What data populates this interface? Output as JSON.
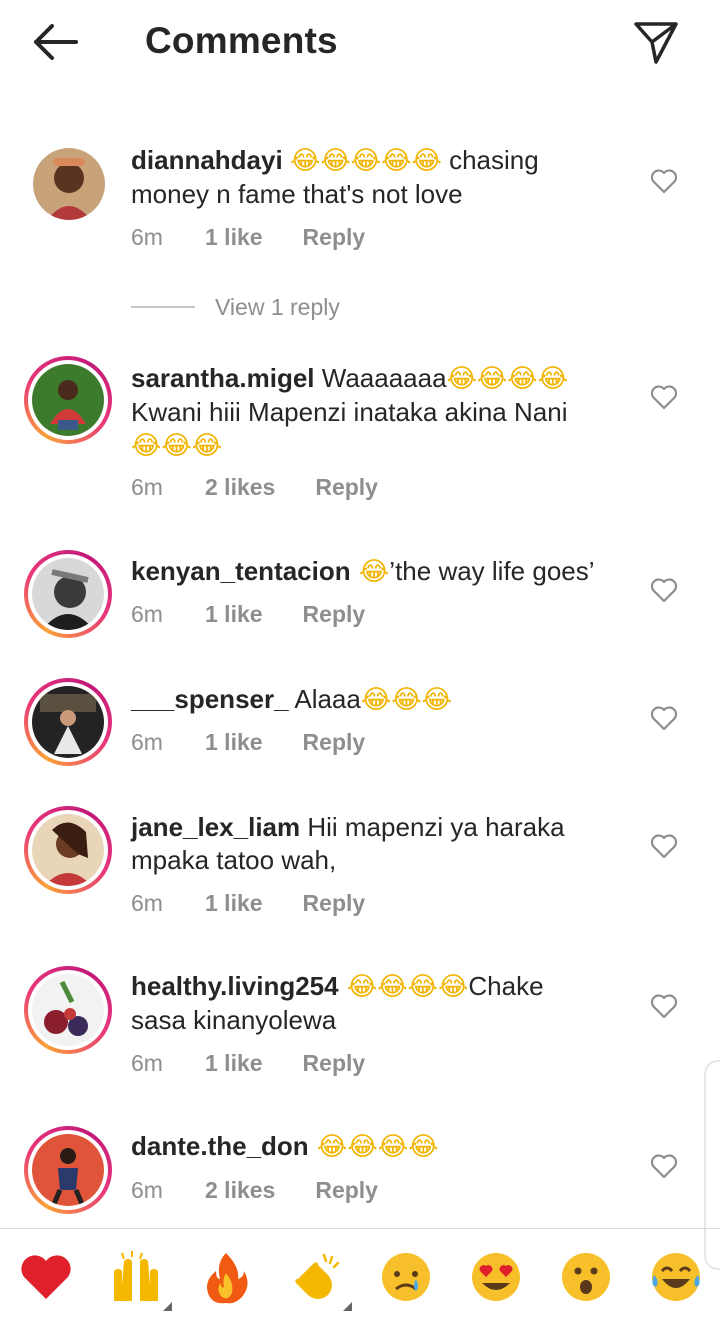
{
  "header": {
    "title": "Comments"
  },
  "comments": [
    {
      "username": "diannahdayi",
      "line1_emojis": "😂😂😂😂😂",
      "text_line1": " chasing",
      "text_line2": "money n fame that's not love",
      "time": "6m",
      "likes": "1 like",
      "reply": "Reply"
    },
    {
      "username": "sarantha.migel",
      "text_line1": " Waaaaaaa",
      "line1_emojis": "😂😂😂😂",
      "text_line2": "Kwani hiii Mapenzi inataka akina Nani",
      "line3_emojis": "😂😂😂",
      "time": "6m",
      "likes": "2 likes",
      "reply": "Reply"
    },
    {
      "username": "kenyan_tentacion",
      "line1_emojis": " 😂",
      "text_line1": "’the way life goes’",
      "time": "6m",
      "likes": "1 like",
      "reply": "Reply"
    },
    {
      "username": "___spenser_",
      "text_line1": " Alaaa",
      "line1_emojis": "😂😂😂",
      "time": "6m",
      "likes": "1 like",
      "reply": "Reply"
    },
    {
      "username": "jane_lex_liam",
      "text_line1": " Hii mapenzi ya haraka",
      "text_line2": "mpaka tatoo wah,",
      "time": "6m",
      "likes": "1 like",
      "reply": "Reply"
    },
    {
      "username": "healthy.living254",
      "line1_emojis": " 😂😂😂😂",
      "text_line1": "Chake",
      "text_line2": "sasa kinanyolewa",
      "time": "6m",
      "likes": "1 like",
      "reply": "Reply"
    },
    {
      "username": "dante.the_don",
      "line1_emojis": " 😂😂😂😂",
      "time": "6m",
      "likes": "2 likes",
      "reply": "Reply"
    }
  ],
  "view_replies": {
    "label": "View 1 reply"
  },
  "icons": {
    "back": "arrow-left-icon",
    "send": "paper-plane-icon",
    "like": "heart-outline-icon"
  },
  "quick_reactions": [
    {
      "name": "red-heart",
      "glyph": "❤️"
    },
    {
      "name": "raising-hands",
      "glyph": "🙌"
    },
    {
      "name": "fire",
      "glyph": "🔥"
    },
    {
      "name": "clapping-hands",
      "glyph": "👏"
    },
    {
      "name": "crying-face",
      "glyph": "😢"
    },
    {
      "name": "heart-eyes",
      "glyph": "😍"
    },
    {
      "name": "surprised-face",
      "glyph": "😮"
    },
    {
      "name": "tears-of-joy",
      "glyph": "😂"
    }
  ],
  "colors": {
    "text": "#262626",
    "muted": "#8e8e8e",
    "story_ring_start": "#f9a23a",
    "story_ring_end": "#c2197a",
    "emoji_yellow": "#f2b400"
  }
}
